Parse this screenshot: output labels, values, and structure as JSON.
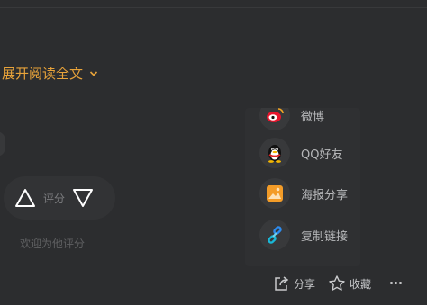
{
  "article": {
    "expand_label": "展开阅读全文"
  },
  "rating": {
    "label": "评分",
    "hint": "欢迎为他评分"
  },
  "share_menu": {
    "items": [
      {
        "label": "微博",
        "icon": "weibo-icon"
      },
      {
        "label": "QQ好友",
        "icon": "qq-icon"
      },
      {
        "label": "海报分享",
        "icon": "poster-icon"
      },
      {
        "label": "复制链接",
        "icon": "link-icon"
      }
    ]
  },
  "actions": {
    "share_label": "分享",
    "favorite_label": "收藏",
    "more_icon": "more-dots-icon"
  },
  "colors": {
    "background": "#2c2d2f",
    "accent": "#e8a33a",
    "popup": "#2f3032"
  }
}
